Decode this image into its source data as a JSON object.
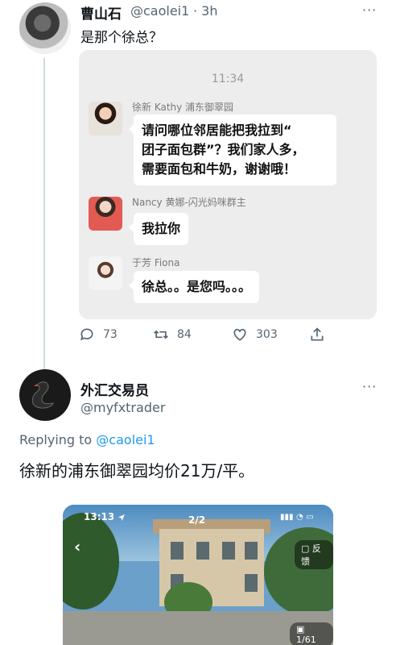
{
  "tweet1": {
    "name": "曹山石",
    "handle": "@caolei1",
    "time": "· 3h",
    "text": "是那个徐总？",
    "more": "···",
    "embed": {
      "time": "11:34",
      "messages": [
        {
          "name": "徐新 Kathy 浦东御翠园",
          "lines": [
            "请问哪位邻居能把我拉到“",
            "团子面包群”？我们家人多，",
            "需要面包和牛奶，谢谢哦！"
          ]
        },
        {
          "name": "Nancy 黄娜-闪光妈咪群主",
          "lines": [
            "我拉你"
          ]
        },
        {
          "name": "于芳 Fiona",
          "lines": [
            "徐总。。是您吗。。。"
          ]
        }
      ]
    },
    "stats": {
      "replies": "73",
      "retweets": "84",
      "likes": "303"
    }
  },
  "tweet2": {
    "name": "外汇交易员",
    "handle": "@myfxtrader",
    "more": "···",
    "reply_prefix": "Replying to ",
    "reply_handle": "@caolei1",
    "text": "徐新的浦东御翠园均价21万/平。",
    "photo": {
      "status_time": "13:13",
      "counter": "2/2",
      "feedback": "反馈",
      "image_count": "1/61"
    }
  },
  "colors": {
    "accent": "#1d9bf0",
    "muted": "#536471",
    "chat_bg": "#ededed"
  },
  "icons": [
    "reply-icon",
    "retweet-icon",
    "like-icon",
    "share-icon",
    "back-icon",
    "feedback-icon",
    "gallery-icon",
    "location-arrow-icon"
  ]
}
